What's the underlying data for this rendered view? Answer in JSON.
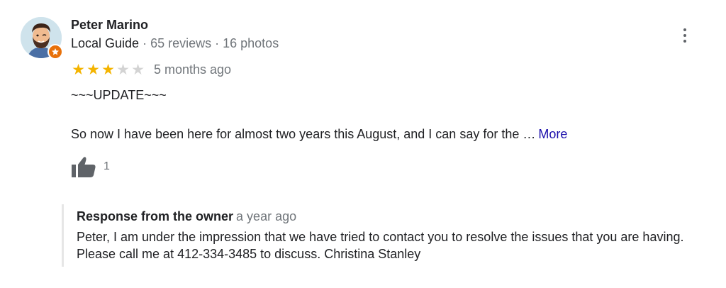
{
  "review": {
    "author": {
      "name": "Peter Marino",
      "guide_label": "Local Guide",
      "separator_1": " · ",
      "reviews_count": "65 reviews",
      "separator_2": " · ",
      "photos_count": "16 photos",
      "avatar_icon": "memoji-avatar-icon",
      "badge_icon": "local-guide-star-icon"
    },
    "rating": {
      "value": 3,
      "max": 5,
      "filled_color": "#f4b400",
      "empty_color": "#d3d3d3"
    },
    "date": "5 months ago",
    "update_line": "~~~UPDATE~~~",
    "text_preview": "So now I have been here for almost two years this August, and I can say for the …",
    "more_label": "More",
    "likes": {
      "icon": "thumbs-up-icon",
      "count": "1"
    },
    "menu_icon": "more-vert-icon"
  },
  "owner_response": {
    "title": "Response from the owner",
    "time": "a year ago",
    "text": "Peter, I am under the impression that we have tried to contact you to resolve the issues that you are having. Please call me at 412-334-3485 to discuss. Christina Stanley"
  },
  "colors": {
    "link": "#1a0dab",
    "secondary_text": "#70757a",
    "primary_text": "#202124",
    "badge": "#e8710a"
  }
}
